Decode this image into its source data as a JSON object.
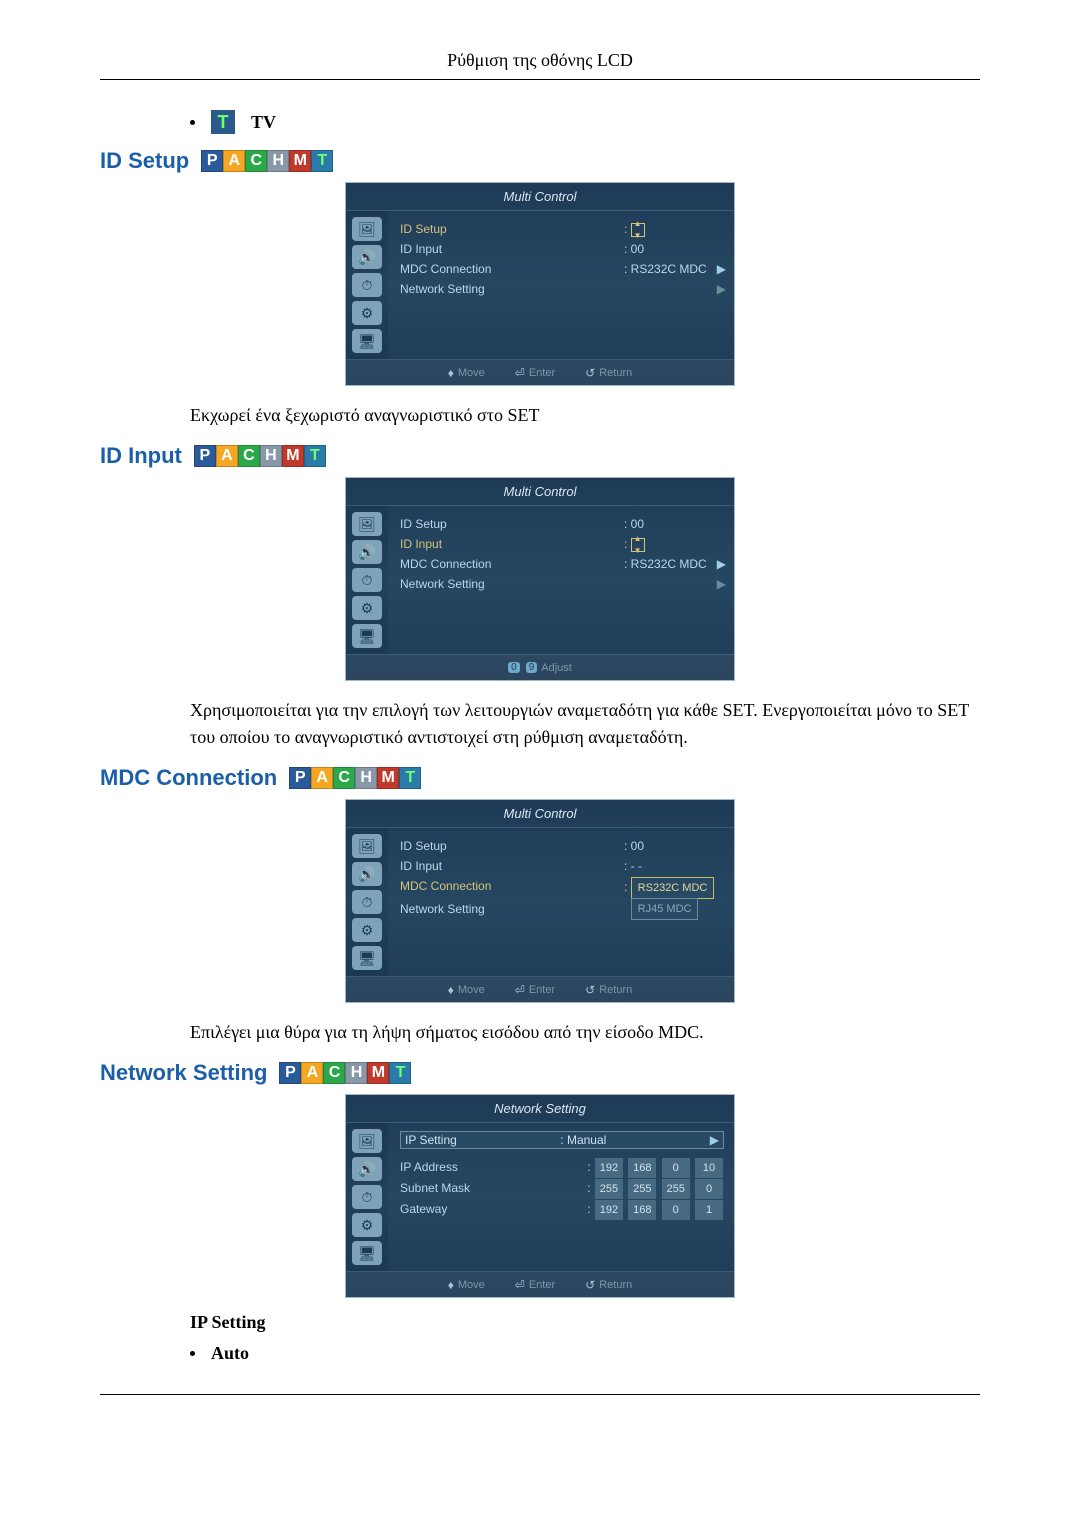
{
  "page_header": "Ρύθμιση της οθόνης LCD",
  "tv_label": "TV",
  "pachmt": {
    "P": "P",
    "A": "A",
    "C": "C",
    "H": "H",
    "M": "M",
    "T": "T"
  },
  "sections": {
    "id_setup": {
      "heading": "ID Setup",
      "desc": "Εκχωρεί ένα ξεχωριστό αναγνωριστικό στο SET"
    },
    "id_input": {
      "heading": "ID Input",
      "desc": "Χρησιμοποιείται για την επιλογή των λειτουργιών αναμεταδότη για κάθε SET. Ενεργοποιείται μόνο το SET του οποίου το αναγνωριστικό αντιστοιχεί στη ρύθμιση αναμεταδότη."
    },
    "mdc_connection": {
      "heading": "MDC Connection",
      "desc": "Επιλέγει μια θύρα για τη λήψη σήματος εισόδου από την είσοδο MDC."
    },
    "network_setting": {
      "heading": "Network Setting"
    }
  },
  "osd_common": {
    "title": "Multi Control",
    "items": {
      "id_setup": "ID Setup",
      "id_input": "ID Input",
      "mdc_connection": "MDC Connection",
      "network_setting": "Network Setting"
    },
    "values": {
      "id_setup": "00",
      "id_input": "- -",
      "mdc": "RS232C MDC",
      "mdc_alt": "RJ45 MDC"
    },
    "buttons": {
      "move": "Move",
      "enter": "Enter",
      "return": "Return",
      "adjust": "Adjust",
      "zero": "0",
      "nine": "9"
    }
  },
  "network_osd": {
    "title": "Network Setting",
    "ip_setting_label": "IP Setting",
    "ip_setting_value": "Manual",
    "ip_address_label": "IP Address",
    "subnet_mask_label": "Subnet Mask",
    "gateway_label": "Gateway",
    "ip_address": [
      "192",
      "168",
      "0",
      "10"
    ],
    "subnet_mask": [
      "255",
      "255",
      "255",
      "0"
    ],
    "gateway": [
      "192",
      "168",
      "0",
      "1"
    ]
  },
  "ip_setting_heading": "IP Setting",
  "ip_setting_option_auto": "Auto"
}
